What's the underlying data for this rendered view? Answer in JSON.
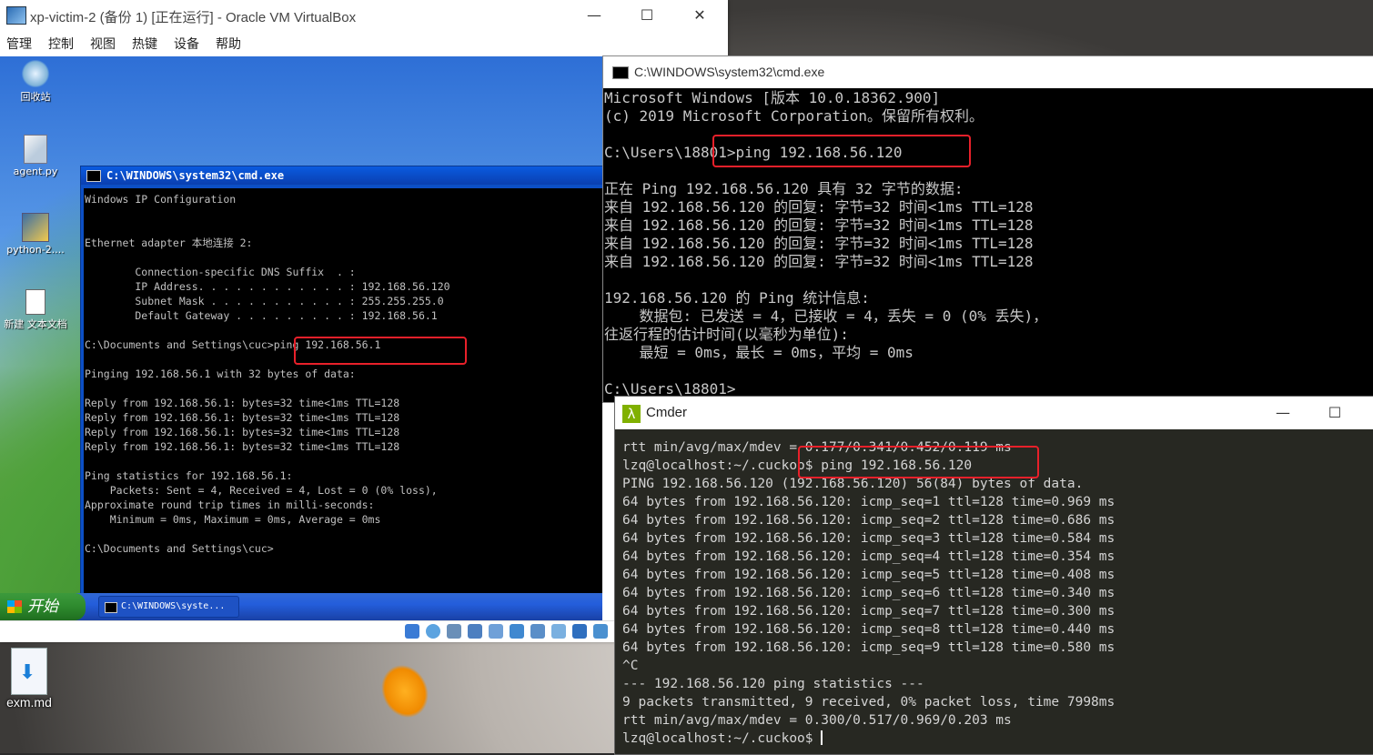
{
  "vbox": {
    "title": "xp-victim-2 (备份 1) [正在运行] - Oracle VM VirtualBox",
    "menu": [
      "管理",
      "控制",
      "视图",
      "热键",
      "设备",
      "帮助"
    ],
    "controls": {
      "minimize": "—",
      "maximize": "☐",
      "close": "✕"
    }
  },
  "xp_desktop": {
    "icons": [
      {
        "label": "回收站",
        "icon": "recycle-bin-icon"
      },
      {
        "label": "agent.py",
        "icon": "python-file-icon"
      },
      {
        "label": "python-2....",
        "icon": "installer-icon"
      },
      {
        "label": "新建 文本文档",
        "icon": "text-file-icon"
      }
    ],
    "start_label": "开始",
    "task_cmd_label": "C:\\WINDOWS\\syste..."
  },
  "xp_cmd": {
    "title": "C:\\WINDOWS\\system32\\cmd.exe",
    "lines": [
      "Windows IP Configuration",
      "",
      "",
      "Ethernet adapter 本地连接 2:",
      "",
      "        Connection-specific DNS Suffix  . :",
      "        IP Address. . . . . . . . . . . . : 192.168.56.120",
      "        Subnet Mask . . . . . . . . . . . : 255.255.255.0",
      "        Default Gateway . . . . . . . . . : 192.168.56.1",
      "",
      "C:\\Documents and Settings\\cuc>ping 192.168.56.1",
      "",
      "Pinging 192.168.56.1 with 32 bytes of data:",
      "",
      "Reply from 192.168.56.1: bytes=32 time<1ms TTL=128",
      "Reply from 192.168.56.1: bytes=32 time<1ms TTL=128",
      "Reply from 192.168.56.1: bytes=32 time<1ms TTL=128",
      "Reply from 192.168.56.1: bytes=32 time<1ms TTL=128",
      "",
      "Ping statistics for 192.168.56.1:",
      "    Packets: Sent = 4, Received = 4, Lost = 0 (0% loss),",
      "Approximate round trip times in milli-seconds:",
      "    Minimum = 0ms, Maximum = 0ms, Average = 0ms",
      "",
      "C:\\Documents and Settings\\cuc>"
    ]
  },
  "win10_cmd": {
    "title": "C:\\WINDOWS\\system32\\cmd.exe",
    "lines": [
      "Microsoft Windows [版本 10.0.18362.900]",
      "(c) 2019 Microsoft Corporation。保留所有权利。",
      "",
      "C:\\Users\\18801>ping 192.168.56.120",
      "",
      "正在 Ping 192.168.56.120 具有 32 字节的数据:",
      "来自 192.168.56.120 的回复: 字节=32 时间<1ms TTL=128",
      "来自 192.168.56.120 的回复: 字节=32 时间<1ms TTL=128",
      "来自 192.168.56.120 的回复: 字节=32 时间<1ms TTL=128",
      "来自 192.168.56.120 的回复: 字节=32 时间<1ms TTL=128",
      "",
      "192.168.56.120 的 Ping 统计信息:",
      "    数据包: 已发送 = 4，已接收 = 4，丢失 = 0 (0% 丢失)，",
      "往返行程的估计时间(以毫秒为单位):",
      "    最短 = 0ms，最长 = 0ms，平均 = 0ms",
      "",
      "C:\\Users\\18801>"
    ]
  },
  "cmder": {
    "title": "Cmder",
    "lines": [
      "rtt min/avg/max/mdev = 0.177/0.341/0.452/0.119 ms",
      "lzq@localhost:~/.cuckoo$ ping 192.168.56.120",
      "PING 192.168.56.120 (192.168.56.120) 56(84) bytes of data.",
      "64 bytes from 192.168.56.120: icmp_seq=1 ttl=128 time=0.969 ms",
      "64 bytes from 192.168.56.120: icmp_seq=2 ttl=128 time=0.686 ms",
      "64 bytes from 192.168.56.120: icmp_seq=3 ttl=128 time=0.584 ms",
      "64 bytes from 192.168.56.120: icmp_seq=4 ttl=128 time=0.354 ms",
      "64 bytes from 192.168.56.120: icmp_seq=5 ttl=128 time=0.408 ms",
      "64 bytes from 192.168.56.120: icmp_seq=6 ttl=128 time=0.340 ms",
      "64 bytes from 192.168.56.120: icmp_seq=7 ttl=128 time=0.300 ms",
      "64 bytes from 192.168.56.120: icmp_seq=8 ttl=128 time=0.440 ms",
      "64 bytes from 192.168.56.120: icmp_seq=9 ttl=128 time=0.580 ms",
      "^C",
      "--- 192.168.56.120 ping statistics ---",
      "9 packets transmitted, 9 received, 0% packet loss, time 7998ms",
      "rtt min/avg/max/mdev = 0.300/0.517/0.969/0.203 ms",
      "lzq@localhost:~/.cuckoo$ "
    ]
  },
  "host_desktop": {
    "icon_label": "exm.md",
    "icon": "download-file-icon"
  },
  "colors": {
    "annotation": "#e8202a",
    "cmder_bg": "#272822",
    "xp_title_blue": "#0a5be0"
  }
}
